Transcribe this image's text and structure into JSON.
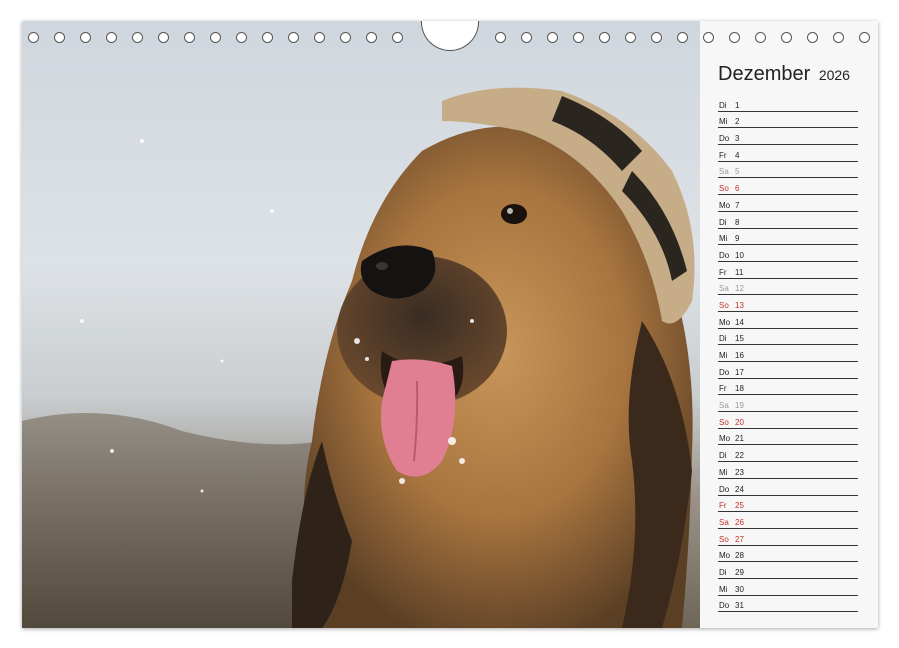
{
  "calendar": {
    "month": "Dezember",
    "year": "2026",
    "days": [
      {
        "wd": "Di",
        "d": "1",
        "type": "normal"
      },
      {
        "wd": "Mi",
        "d": "2",
        "type": "normal"
      },
      {
        "wd": "Do",
        "d": "3",
        "type": "normal"
      },
      {
        "wd": "Fr",
        "d": "4",
        "type": "normal"
      },
      {
        "wd": "Sa",
        "d": "5",
        "type": "sat"
      },
      {
        "wd": "So",
        "d": "6",
        "type": "sun"
      },
      {
        "wd": "Mo",
        "d": "7",
        "type": "normal"
      },
      {
        "wd": "Di",
        "d": "8",
        "type": "normal"
      },
      {
        "wd": "Mi",
        "d": "9",
        "type": "normal"
      },
      {
        "wd": "Do",
        "d": "10",
        "type": "normal"
      },
      {
        "wd": "Fr",
        "d": "11",
        "type": "normal"
      },
      {
        "wd": "Sa",
        "d": "12",
        "type": "sat"
      },
      {
        "wd": "So",
        "d": "13",
        "type": "sun"
      },
      {
        "wd": "Mo",
        "d": "14",
        "type": "normal"
      },
      {
        "wd": "Di",
        "d": "15",
        "type": "normal"
      },
      {
        "wd": "Mi",
        "d": "16",
        "type": "normal"
      },
      {
        "wd": "Do",
        "d": "17",
        "type": "normal"
      },
      {
        "wd": "Fr",
        "d": "18",
        "type": "normal"
      },
      {
        "wd": "Sa",
        "d": "19",
        "type": "sat"
      },
      {
        "wd": "So",
        "d": "20",
        "type": "sun"
      },
      {
        "wd": "Mo",
        "d": "21",
        "type": "normal"
      },
      {
        "wd": "Di",
        "d": "22",
        "type": "normal"
      },
      {
        "wd": "Mi",
        "d": "23",
        "type": "normal"
      },
      {
        "wd": "Do",
        "d": "24",
        "type": "normal"
      },
      {
        "wd": "Fr",
        "d": "25",
        "type": "sun"
      },
      {
        "wd": "Sa",
        "d": "26",
        "type": "sun"
      },
      {
        "wd": "So",
        "d": "27",
        "type": "sun"
      },
      {
        "wd": "Mo",
        "d": "28",
        "type": "normal"
      },
      {
        "wd": "Di",
        "d": "29",
        "type": "normal"
      },
      {
        "wd": "Mi",
        "d": "30",
        "type": "normal"
      },
      {
        "wd": "Do",
        "d": "31",
        "type": "normal"
      }
    ]
  },
  "photo": {
    "subject": "dog-with-cap-icon"
  },
  "colors": {
    "holiday": "#c2302a",
    "saturday": "#999999",
    "text": "#222222"
  }
}
